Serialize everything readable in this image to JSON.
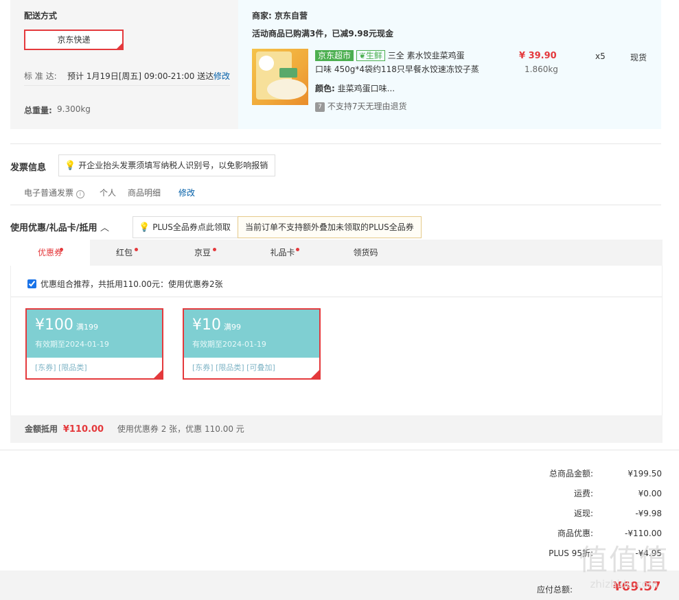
{
  "delivery": {
    "title": "配送方式",
    "method": "京东快递",
    "standard_label": "标 准 达:",
    "standard_value": "预计 1月19日[周五] 09:00-21:00 送达",
    "modify": "修改",
    "weight_label": "总重量:",
    "weight_value": "9.300kg"
  },
  "shop": {
    "merchant_label": "商家:",
    "merchant_name": "京东自营",
    "promo": "活动商品已购满3件，已减9.98元现金",
    "product": {
      "tag_market": "京东超市",
      "tag_fresh": "生鲜",
      "title_line1": "三全 素水饺韭菜鸡蛋",
      "title_line2": "口味 450g*4袋约118只早餐水饺速冻饺子蒸",
      "color_label": "颜色:",
      "color_value": "韭菜鸡蛋口味...",
      "return_note": "不支持7天无理由退货",
      "price": "¥ 39.90",
      "weight": "1.860kg",
      "qty": "x5",
      "stock": "现货"
    }
  },
  "invoice": {
    "title": "发票信息",
    "tip": "开企业抬头发票须填写纳税人识别号，以免影响报销",
    "type": "电子普通发票",
    "person": "个人",
    "detail": "商品明细",
    "modify": "修改"
  },
  "discount": {
    "title": "使用优惠/礼品卡/抵用",
    "tip1": "PLUS全品券点此领取",
    "tip2": "当前订单不支持额外叠加未领取的PLUS全品券",
    "tabs": [
      "优惠券",
      "红包",
      "京豆",
      "礼品卡",
      "领货码"
    ],
    "combo_text": "优惠组合推荐，共抵用110.00元：使用优惠券2张",
    "coupons": [
      {
        "amount": "¥100",
        "cond": "满199",
        "expire": "有效期至2024-01-19",
        "tags": "[东券]  [限品类]"
      },
      {
        "amount": "¥10",
        "cond": "满99",
        "expire": "有效期至2024-01-19",
        "tags": "[东券]  [限品类]  [可叠加]"
      }
    ],
    "sum_label": "金额抵用",
    "sum_value": "¥110.00",
    "sum_desc": "使用优惠券 2 张，优惠 110.00 元"
  },
  "summary": {
    "rows": [
      {
        "k": "总商品金额:",
        "v": "¥199.50"
      },
      {
        "k": "运费:",
        "v": "¥0.00"
      },
      {
        "k": "返现:",
        "v": "-¥9.98"
      },
      {
        "k": "商品优惠:",
        "v": "-¥110.00"
      },
      {
        "k": "PLUS 95折:",
        "v": "-¥4.95"
      }
    ],
    "pay_label": "应付总额:",
    "pay_value": "¥69.57"
  },
  "watermark": "zhizhidu.com",
  "colors": {
    "accent": "#e4393c",
    "coupon": "#7fcfd2",
    "link": "#005ea7",
    "fresh": "#4caf50"
  }
}
